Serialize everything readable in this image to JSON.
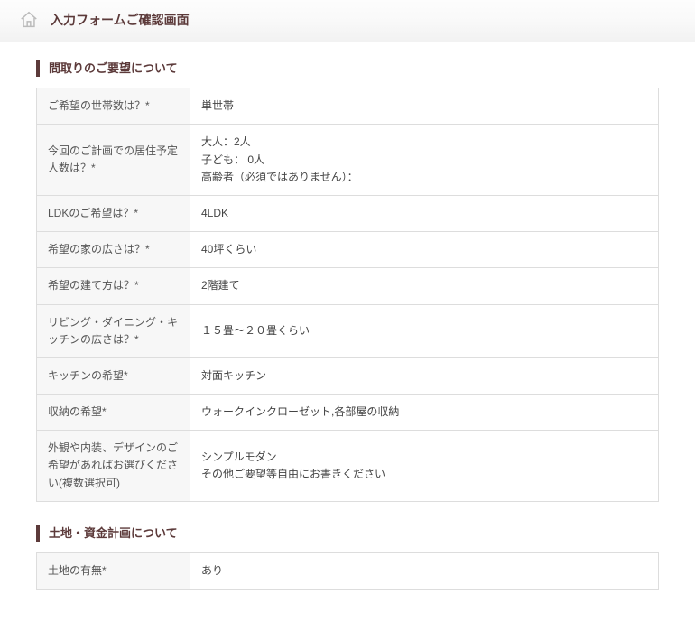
{
  "header": {
    "page_title": "入力フォームご確認画面"
  },
  "sections": {
    "floorplan": {
      "title": "間取りのご要望について",
      "rows": [
        {
          "label": "ご希望の世帯数は？*",
          "value": "単世帯"
        },
        {
          "label": "今回のご計画での居住予定人数は？*",
          "value": "大人：2人\n子ども： 0人\n高齢者（必須ではありません）："
        },
        {
          "label": "LDKのご希望は？*",
          "value": "4LDK"
        },
        {
          "label": "希望の家の広さは？*",
          "value": "40坪くらい"
        },
        {
          "label": "希望の建て方は？*",
          "value": "2階建て"
        },
        {
          "label": "リビング・ダイニング・キッチンの広さは？*",
          "value": "１５畳〜２０畳くらい"
        },
        {
          "label": "キッチンの希望*",
          "value": "対面キッチン"
        },
        {
          "label": "収納の希望*",
          "value": "ウォークインクローゼット,各部屋の収納"
        },
        {
          "label": "外観や内装、デザインのご希望があればお選びください(複数選択可)",
          "value": "シンプルモダン\nその他ご要望等自由にお書きください"
        }
      ]
    },
    "land_funding": {
      "title": "土地・資金計画について",
      "rows": [
        {
          "label": "土地の有無*",
          "value": "あり"
        }
      ]
    }
  }
}
